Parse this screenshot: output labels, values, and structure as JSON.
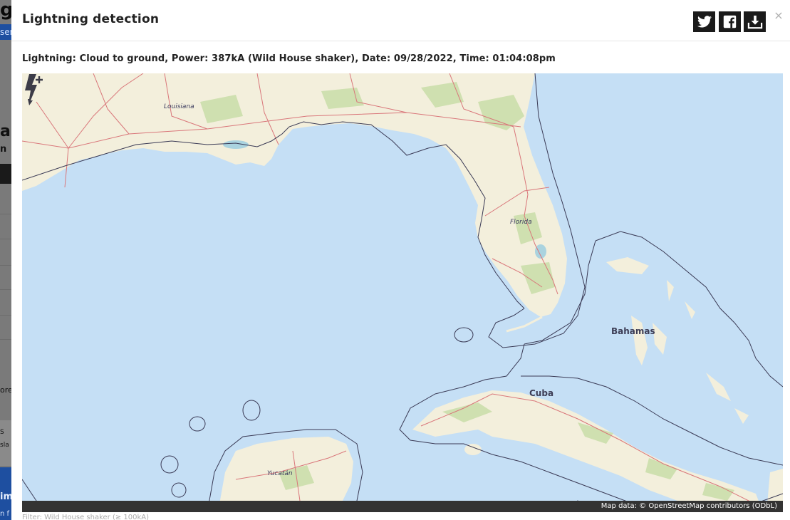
{
  "background": {
    "logo_fragment": "g",
    "pill_fragment": "ser",
    "text_fragments": [
      "ar",
      "n",
      "ore",
      "S",
      "sla",
      "im",
      "n f"
    ]
  },
  "modal": {
    "title": "Lightning detection",
    "detail": "Lightning: Cloud to ground, Power: 387kA (Wild House shaker), Date: 09/28/2022, Time: 01:04:08pm",
    "share_buttons": [
      {
        "name": "twitter",
        "icon": "twitter-icon"
      },
      {
        "name": "facebook",
        "icon": "facebook-icon"
      },
      {
        "name": "download",
        "icon": "download-icon"
      }
    ],
    "close_label": "×",
    "footer_text": "Filter: Wild House shaker (≥ 100kA)"
  },
  "map": {
    "labels": {
      "louisiana": "Louisiana",
      "florida": "Florida",
      "bahamas": "Bahamas",
      "cuba": "Cuba",
      "yucatan": "Yucatán"
    },
    "attribution": "Map data: © OpenStreetMap contributors (ODbL)",
    "colors": {
      "water": "#c5dff5",
      "land": "#f3efdc",
      "forest": "#cfe0b0",
      "roads": "#d9767a",
      "border": "#3a3a55",
      "strike": "#3c3c48"
    },
    "strike": {
      "type": "cloud-to-ground",
      "polarity": "+",
      "icon": "lightning-strike-icon"
    }
  }
}
